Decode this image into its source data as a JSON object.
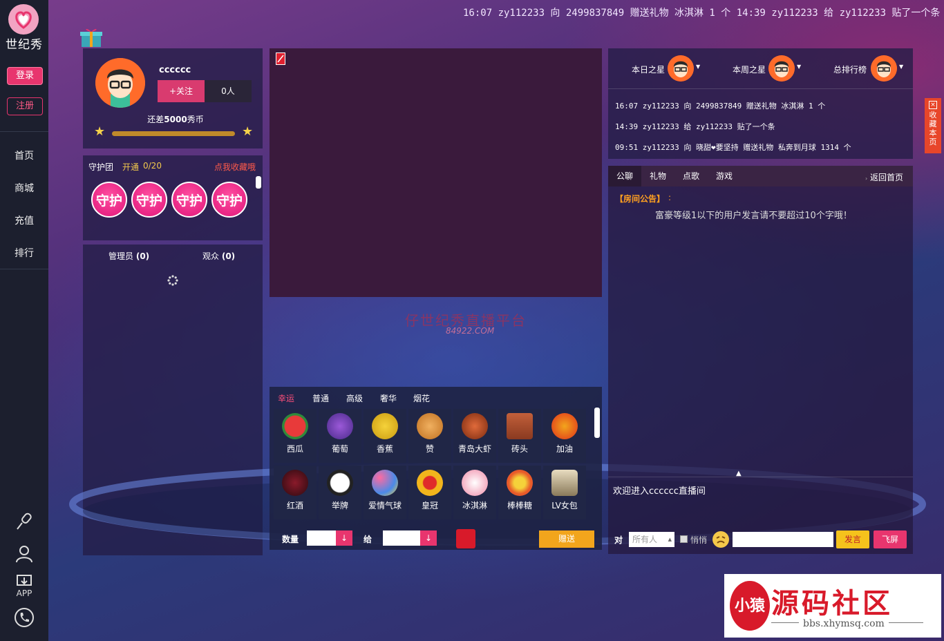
{
  "brand": {
    "logo_text": "世纪秀"
  },
  "nav": {
    "login": "登录",
    "register": "注册",
    "items": [
      {
        "label": "首页"
      },
      {
        "label": "商城"
      },
      {
        "label": "充值"
      },
      {
        "label": "排行"
      }
    ],
    "bottom": {
      "app_label": "APP"
    }
  },
  "ticker": "16:07 zy112233 向 2499837849 赠送礼物 冰淇淋 1 个 14:39 zy112233 给 zy112233 贴了一个条",
  "profile": {
    "username": "cccccc",
    "follow": "+关注",
    "fans": "0人",
    "coin_prefix": "还差",
    "coin_value": "5000",
    "coin_suffix": "秀币"
  },
  "guard": {
    "title": "守护团",
    "open": "开通",
    "count": "0/20",
    "collect": "点我收藏哦",
    "badge": "守护"
  },
  "users": {
    "admins": "管理员",
    "admins_count": "(0)",
    "audience": "观众",
    "audience_count": "(0)"
  },
  "watermark": {
    "text": "仔世纪秀直播平台",
    "url": "84922.COM"
  },
  "gifts": {
    "tabs": [
      "幸运",
      "普通",
      "高级",
      "奢华",
      "烟花"
    ],
    "row1": [
      "西瓜",
      "葡萄",
      "香蕉",
      "赞",
      "青岛大虾",
      "砖头",
      "加油"
    ],
    "row2": [
      "红酒",
      "举牌",
      "爱情气球",
      "皇冠",
      "冰淇淋",
      "棒棒糖",
      "LV女包"
    ],
    "qty_label": "数量",
    "to_label": "给",
    "send": "赠送"
  },
  "ranks": {
    "day": "本日之星",
    "week": "本周之星",
    "total": "总排行榜"
  },
  "gift_log": [
    "16:07 zy112233 向 2499837849 赠送礼物 冰淇淋 1 个",
    "14:39 zy112233 给 zy112233 贴了一个条",
    "09:51 zy112233 向 晓甜❤要坚持 赠送礼物 私奔到月球 1314 个"
  ],
  "chat": {
    "tabs": [
      "公聊",
      "礼物",
      "点歌",
      "游戏"
    ],
    "back_home": "返回首页",
    "announce_label": "【房间公告】",
    "announce_colon": ":",
    "announce_text": "富豪等级1以下的用户发言请不要超过10个字哦！",
    "welcome": "欢迎进入cccccc直播间",
    "to_label": "对",
    "target": "所有人",
    "whisper": "悄悄",
    "send": "发言",
    "fly": "飞屏"
  },
  "side_collect": "收藏本页",
  "footer": {
    "title": "源码社区",
    "url": "bbs.xhymsq.com",
    "badge": "小猿"
  },
  "colors": {
    "accent": "#e8356e",
    "gold": "#f2a51c",
    "orange": "#ff6b2a"
  }
}
